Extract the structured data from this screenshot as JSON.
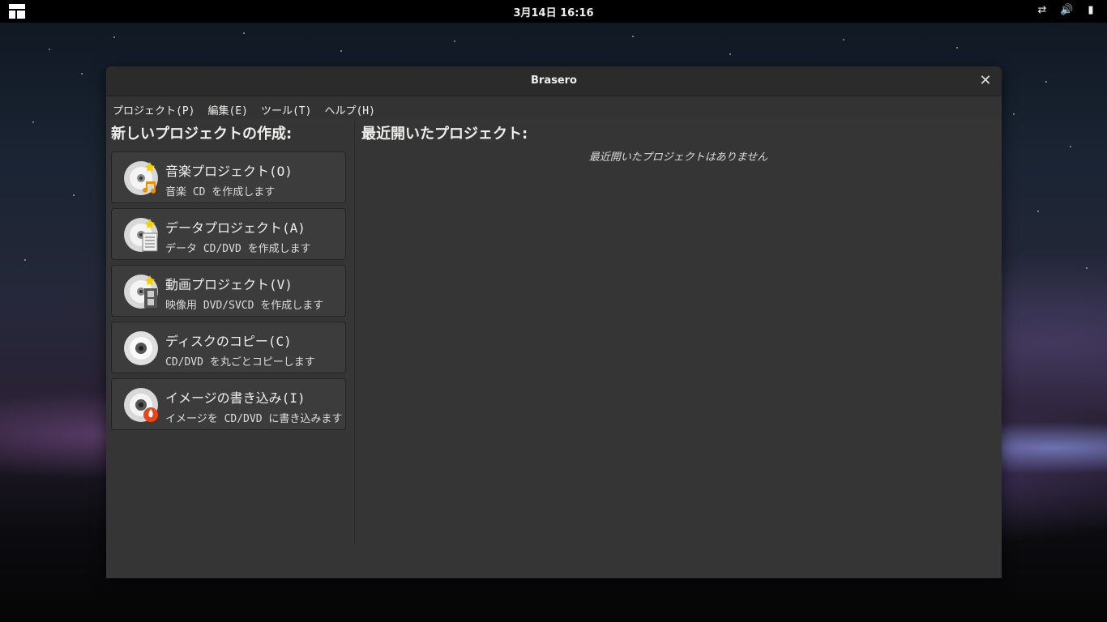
{
  "topbar": {
    "clock": "3月14日 16:16",
    "tray_icons": [
      "network-icon",
      "volume-icon",
      "battery-icon"
    ]
  },
  "window": {
    "title": "Brasero",
    "menu": [
      "プロジェクト(P)",
      "編集(E)",
      "ツール(T)",
      "ヘルプ(H)"
    ],
    "new_project_header": "新しいプロジェクトの作成:",
    "recent_header": "最近開いたプロジェクト:",
    "recent_empty": "最近開いたプロジェクトはありません",
    "projects": [
      {
        "title": "音楽プロジェクト(O)",
        "subtitle": "音楽 CD を作成します",
        "icon": "audio-disc-icon"
      },
      {
        "title": "データプロジェクト(A)",
        "subtitle": "データ CD/DVD を作成します",
        "icon": "data-disc-icon"
      },
      {
        "title": "動画プロジェクト(V)",
        "subtitle": "映像用 DVD/SVCD を作成します",
        "icon": "video-disc-icon"
      },
      {
        "title": "ディスクのコピー(C)",
        "subtitle": "CD/DVD を丸ごとコピーします",
        "icon": "disc-copy-icon"
      },
      {
        "title": "イメージの書き込み(I)",
        "subtitle": "イメージを CD/DVD に書き込みます",
        "icon": "burn-image-icon"
      }
    ]
  }
}
